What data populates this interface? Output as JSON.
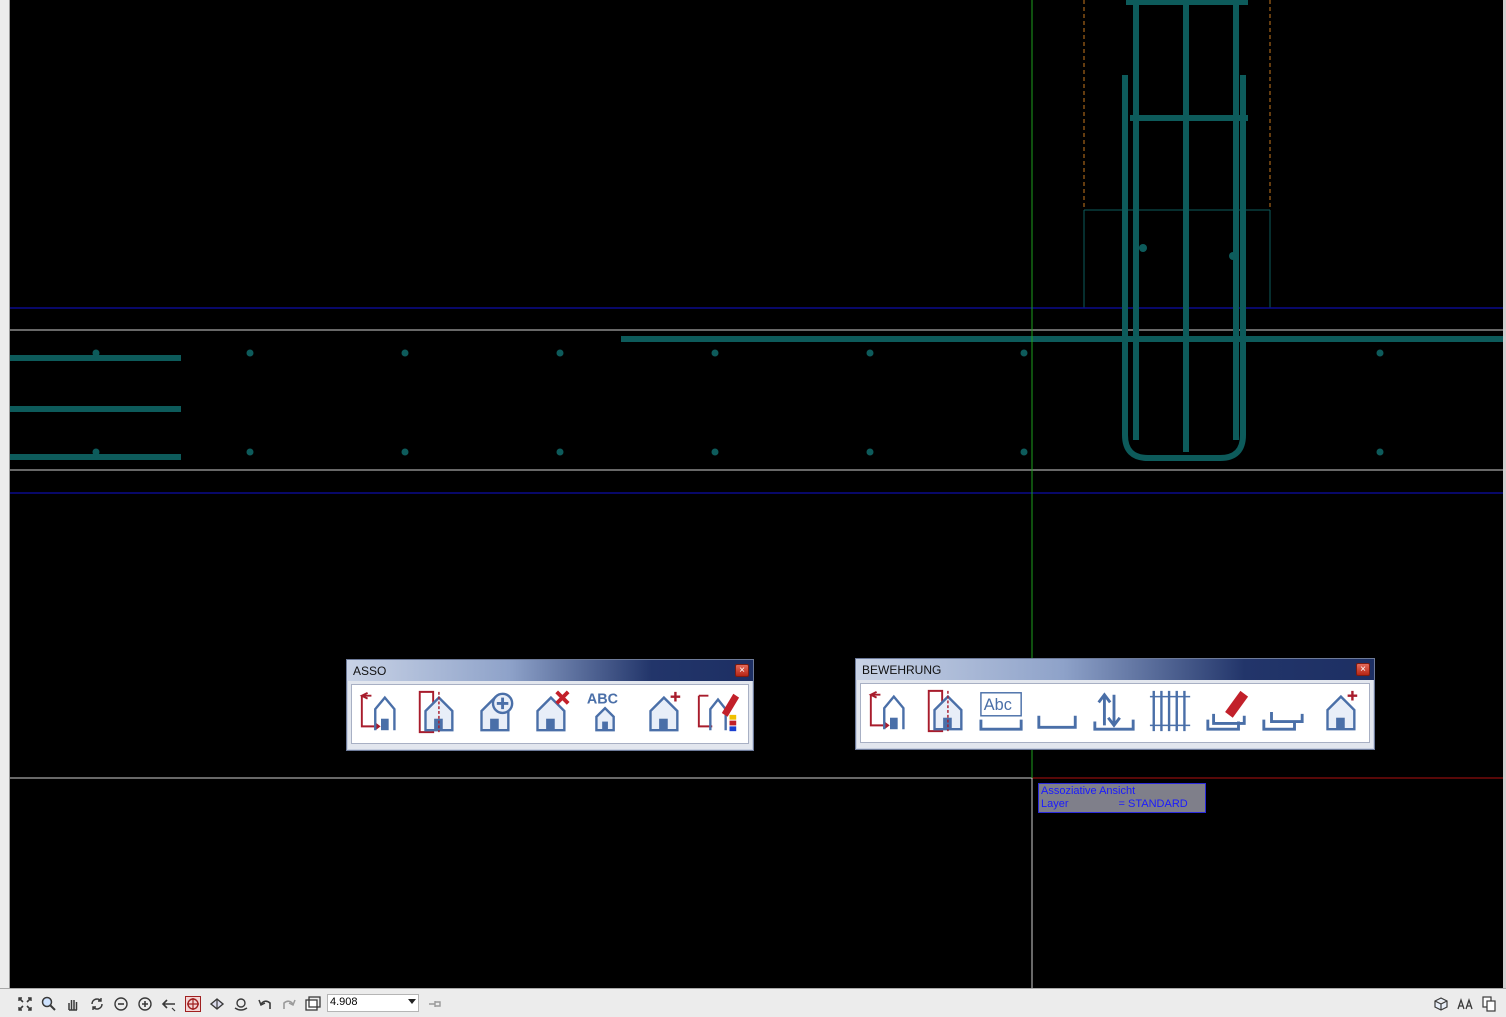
{
  "colors": {
    "canvas_bg": "#000000",
    "rebar": "#0d5b5b",
    "guide_green": "#1ea11e",
    "axis_blue": "#0a0a8c",
    "line_white": "#d0d0d0",
    "dashed_orange": "#c8781e",
    "line_red": "#b01010",
    "icon_red": "#a81c2c",
    "icon_blue": "#4a6fa8"
  },
  "toolbar_asso": {
    "title": "ASSO",
    "close_symbol": "×",
    "buttons": [
      {
        "icon": "assoc-view-icon"
      },
      {
        "icon": "assoc-section-icon"
      },
      {
        "icon": "assoc-add-icon"
      },
      {
        "icon": "assoc-delete-icon"
      },
      {
        "icon": "assoc-label-abc-icon"
      },
      {
        "icon": "assoc-new-icon"
      },
      {
        "icon": "assoc-edit-layer-icon"
      }
    ]
  },
  "toolbar_bewehrung": {
    "title": "BEWEHRUNG",
    "close_symbol": "×",
    "buttons": [
      {
        "icon": "rebar-view-icon"
      },
      {
        "icon": "rebar-section-icon"
      },
      {
        "icon": "rebar-label-abc-icon"
      },
      {
        "icon": "rebar-stirrup-icon"
      },
      {
        "icon": "rebar-bend-icon"
      },
      {
        "icon": "rebar-distribution-icon"
      },
      {
        "icon": "rebar-edit-icon"
      },
      {
        "icon": "rebar-schedule-icon"
      },
      {
        "icon": "rebar-new-icon"
      }
    ]
  },
  "tooltip": {
    "line1": "Assoziative Ansicht",
    "line2_label": "Layer",
    "line2_value": "= STANDARD"
  },
  "statusbar": {
    "zoom_value": "4.908",
    "left_icons": [
      "zoom-all-icon",
      "zoom-window-icon",
      "pan-icon",
      "redraw-icon",
      "zoom-out-icon",
      "zoom-in-icon",
      "previous-view-icon",
      "snap-grid-icon",
      "orbit-icon",
      "rotate-view-icon",
      "undo-icon",
      "redo-icon",
      "plot-frame-icon"
    ],
    "right_icons": [
      "view-3d-icon",
      "text-scale-icon",
      "copy-doc-icon"
    ]
  }
}
